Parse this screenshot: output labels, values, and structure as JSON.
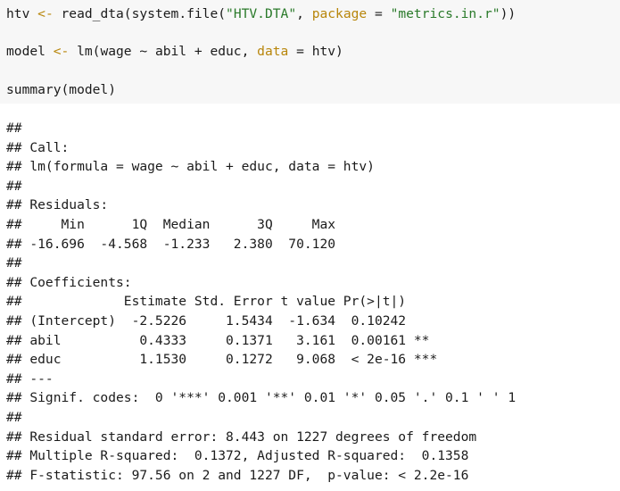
{
  "code": {
    "line1": {
      "p1": "htv ",
      "p2": "<-",
      "p3": " read_dta(system.file(",
      "p4": "\"HTV.DTA\"",
      "p5": ", ",
      "p6": "package",
      "p7": " = ",
      "p8": "\"metrics.in.r\"",
      "p9": "))"
    },
    "line2": {
      "p1": "model ",
      "p2": "<-",
      "p3": " lm(wage ~ abil + educ, ",
      "p4": "data",
      "p5": " = ",
      "p6": "htv)"
    },
    "line3": "summary(model)"
  },
  "output": {
    "lines": [
      "##",
      "## Call:",
      "## lm(formula = wage ~ abil + educ, data = htv)",
      "##",
      "## Residuals:",
      "##     Min      1Q  Median      3Q     Max",
      "## -16.696  -4.568  -1.233   2.380  70.120",
      "##",
      "## Coefficients:",
      "##             Estimate Std. Error t value Pr(>|t|)",
      "## (Intercept)  -2.5226     1.5434  -1.634  0.10242",
      "## abil          0.4333     0.1371   3.161  0.00161 **",
      "## educ          1.1530     0.1272   9.068  < 2e-16 ***",
      "## ---",
      "## Signif. codes:  0 '***' 0.001 '**' 0.01 '*' 0.05 '.' 0.1 ' ' 1",
      "##",
      "## Residual standard error: 8.443 on 1227 degrees of freedom",
      "## Multiple R-squared:  0.1372, Adjusted R-squared:  0.1358",
      "## F-statistic: 97.56 on 2 and 1227 DF,  p-value: < 2.2e-16"
    ]
  }
}
